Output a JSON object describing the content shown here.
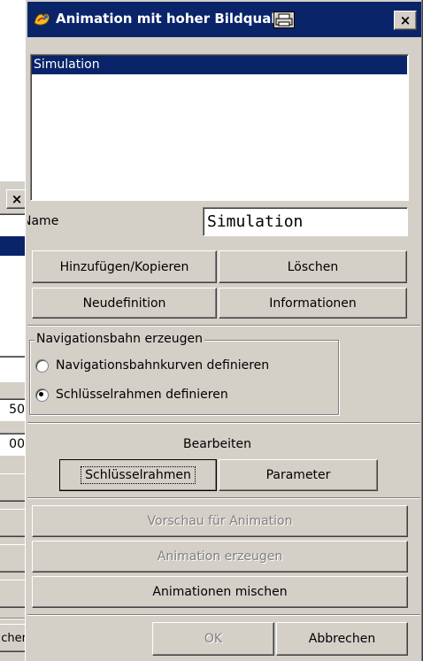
{
  "back_dialog": {
    "close_label": "×",
    "value_1": "50",
    "value_2": "00",
    "button_last": "cher"
  },
  "dialog": {
    "title": "Animation mit hoher Bildqual",
    "close_label": "×",
    "list": {
      "selected_item": "Simulation"
    },
    "name_label": "Name",
    "name_value": "Simulation",
    "buttons": {
      "add_copy": "Hinzufügen/Kopieren",
      "delete": "Löschen",
      "redefine": "Neudefinition",
      "info": "Informationen"
    },
    "nav_group": {
      "title": "Navigationsbahn erzeugen",
      "option_curves": "Navigationsbahnkurven definieren",
      "option_keyframes": "Schlüsselrahmen definieren",
      "selected": "option_keyframes"
    },
    "edit_label": "Bearbeiten",
    "edit_buttons": {
      "keyframes": "Schlüsselrahmen",
      "parameters": "Parameter"
    },
    "preview": "Vorschau für Animation",
    "generate": "Animation erzeugen",
    "mix": "Animationen mischen",
    "ok": "OK",
    "cancel": "Abbrechen"
  },
  "colors": {
    "titlebar": "#0a246a",
    "selection": "#0a246a",
    "face": "#d4d0c8"
  }
}
